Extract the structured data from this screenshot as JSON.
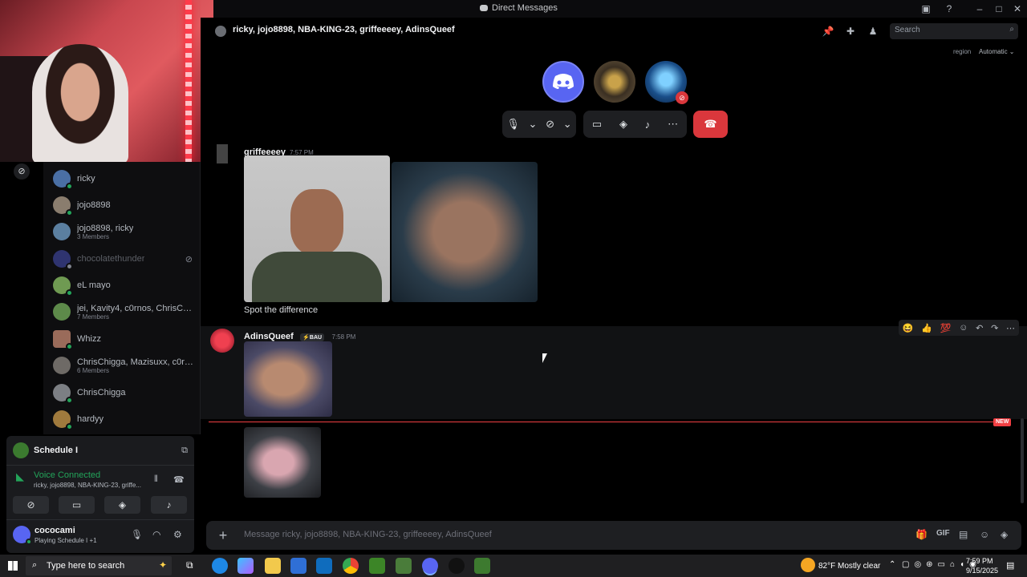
{
  "window": {
    "title": "Direct Messages"
  },
  "header": {
    "channel_title": "ricky, jojo8898, NBA-KING-23, griffeeeey, AdinsQueef",
    "search_placeholder": "Search",
    "region_label": "region",
    "region_value": "Automatic"
  },
  "dm_list": [
    {
      "name": "ricky",
      "sub": "",
      "status": "online"
    },
    {
      "name": "jojo8898",
      "sub": "",
      "status": "online"
    },
    {
      "name": "jojo8898, ricky",
      "sub": "3 Members",
      "status": ""
    },
    {
      "name": "chocolatethunder",
      "sub": "",
      "status": "offline"
    },
    {
      "name": "eL mayo",
      "sub": "",
      "status": "online"
    },
    {
      "name": "jei, Kavity4, c0rnos, ChrisCh...",
      "sub": "7 Members",
      "status": ""
    },
    {
      "name": "Whizz",
      "sub": "",
      "status": "online"
    },
    {
      "name": "ChrisChigga, Mazisuxx, c0rn...",
      "sub": "6 Members",
      "status": ""
    },
    {
      "name": "ChrisChigga",
      "sub": "",
      "status": "online"
    },
    {
      "name": "hardyy",
      "sub": "",
      "status": "online"
    }
  ],
  "activity": {
    "title": "Schedule I"
  },
  "voice": {
    "status": "Voice Connected",
    "channel": "ricky, jojo8898, NBA-KING-23, griffe..."
  },
  "user": {
    "name": "cococami",
    "activity": "Playing Schedule I +1"
  },
  "messages": [
    {
      "author": "griffeeeey",
      "time": "7:57 PM",
      "text": "Spot the difference"
    },
    {
      "author": "AdinsQueef",
      "badge": "BAU",
      "time": "7:58 PM",
      "text": ""
    }
  ],
  "new_marker": "NEW",
  "composer": {
    "placeholder": "Message ricky, jojo8898, NBA-KING-23, griffeeeey, AdinsQueef"
  },
  "taskbar": {
    "search_placeholder": "Type here to search",
    "weather_temp": "82°F",
    "weather_text": "Mostly clear",
    "time": "7:59 PM",
    "date": "9/15/2025"
  },
  "colors": {
    "accent": "#5865f2",
    "online": "#23a55a",
    "hangup": "#da373c",
    "voice_green": "#23a55a",
    "new_red": "#f23f43"
  }
}
